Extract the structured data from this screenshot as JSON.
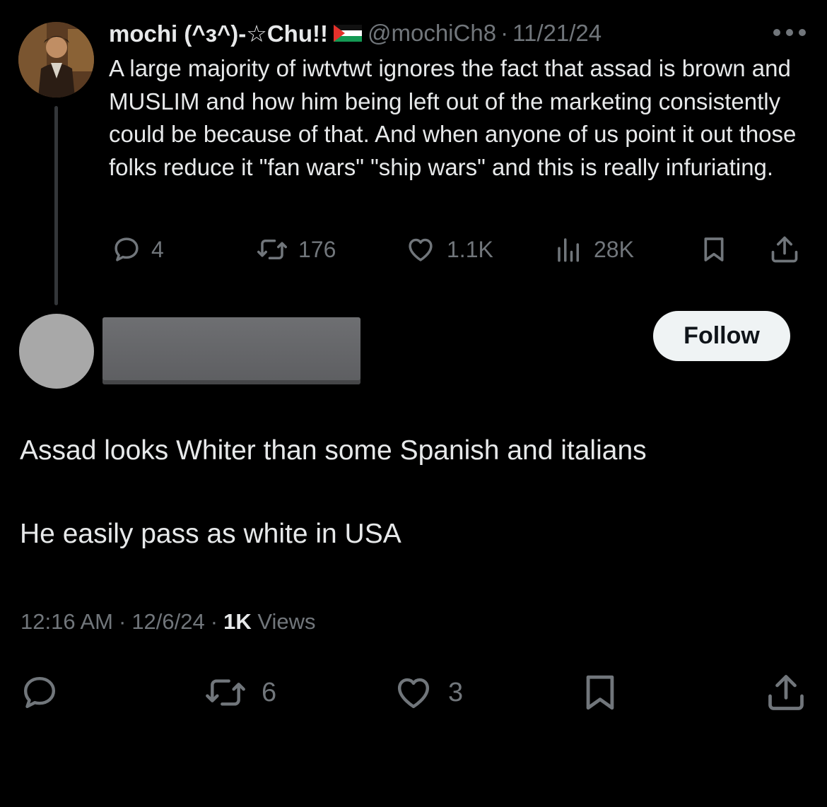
{
  "parent_tweet": {
    "display_name": "mochi (^з^)-☆Chu!!",
    "handle": "@mochiCh8",
    "separator": "·",
    "date": "11/21/24",
    "text": "A large majority of iwtvtwt ignores the fact that assad is brown and MUSLIM and how him being left out of the marketing consistently could be because of that. And when anyone of us point it out those folks reduce it \"fan wars\" \"ship wars\" and this is really infuriating.",
    "replies": "4",
    "reposts": "176",
    "likes": "1.1K",
    "views": "28K"
  },
  "reply_tweet": {
    "follow_label": "Follow",
    "line1": "Assad looks Whiter than some Spanish and italians",
    "line2": "He easily pass as white in USA",
    "time": "12:16 AM",
    "date": "12/6/24",
    "separator": "·",
    "views_count": "1K",
    "views_label": "Views",
    "reposts": "6",
    "likes": "3"
  },
  "colors": {
    "background": "#000000",
    "text_primary": "#e7e9ea",
    "text_secondary": "#71767b",
    "follow_bg": "#eff3f4"
  },
  "icons": [
    "reply-icon",
    "repost-icon",
    "like-icon",
    "views-icon",
    "bookmark-icon",
    "share-icon",
    "more-icon",
    "palestine-flag-icon"
  ]
}
